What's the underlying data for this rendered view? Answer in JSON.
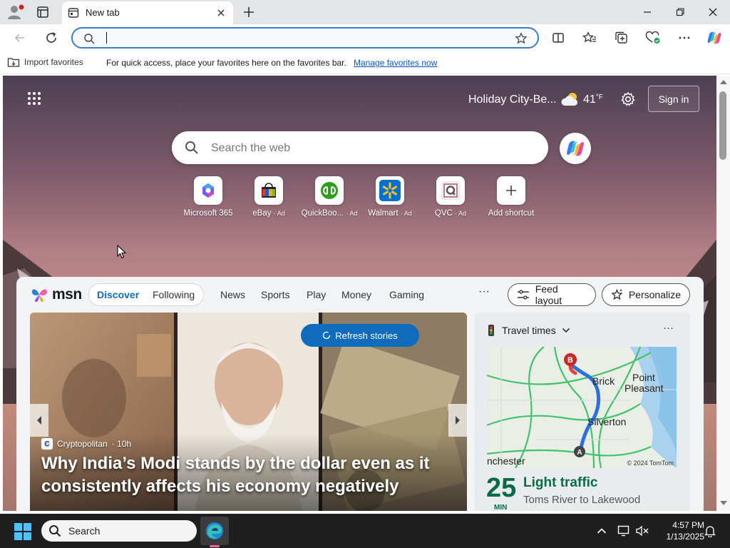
{
  "browser": {
    "tab_title": "New tab",
    "address_value": "",
    "favorites": {
      "import_label": "Import favorites",
      "hint": "For quick access, place your favorites here on the favorites bar.",
      "manage_link": "Manage favorites now"
    }
  },
  "ntp": {
    "location": "Holiday City-Be...",
    "temperature": "41",
    "temp_unit": "°F",
    "signin_label": "Sign in",
    "search_placeholder": "Search the web",
    "shortcuts": [
      {
        "label": "Microsoft 365",
        "ad": ""
      },
      {
        "label": "eBay",
        "ad": "· Ad"
      },
      {
        "label": "QuickBoo...",
        "ad": "· Ad"
      },
      {
        "label": "Walmart",
        "ad": "· Ad"
      },
      {
        "label": "QVC",
        "ad": "· Ad"
      },
      {
        "label": "Add shortcut",
        "ad": ""
      }
    ]
  },
  "feed": {
    "logo_text": "msn",
    "tabs": {
      "discover": "Discover",
      "following": "Following"
    },
    "nav": [
      "News",
      "Sports",
      "Play",
      "Money",
      "Gaming"
    ],
    "more": "···",
    "feed_layout_label": "Feed layout",
    "personalize_label": "Personalize",
    "refresh_label": "Refresh stories",
    "hero": {
      "source": "Cryptopolitan",
      "age": "· 10h",
      "headline": "Why India’s Modi stands by the dollar even as it consistently affects his economy negatively"
    },
    "travel": {
      "title": "Travel times",
      "map_labels": {
        "brick": "Brick",
        "point": "Point",
        "pleasant": "Pleasant",
        "silverton": "Silverton",
        "chester": "nchester",
        "marker_a": "A",
        "marker_b": "B"
      },
      "map_credit": "© 2024 TomTom",
      "minutes": "25",
      "min_label": "MIN",
      "status": "Light traffic",
      "route": "Toms River to Lakewood"
    }
  },
  "taskbar": {
    "search_label": "Search",
    "time": "4:57 PM",
    "date": "1/13/2025"
  },
  "colors": {
    "accent": "#0f6cbd",
    "traffic_green": "#0b6b45",
    "address_border": "#3a7bd5"
  }
}
